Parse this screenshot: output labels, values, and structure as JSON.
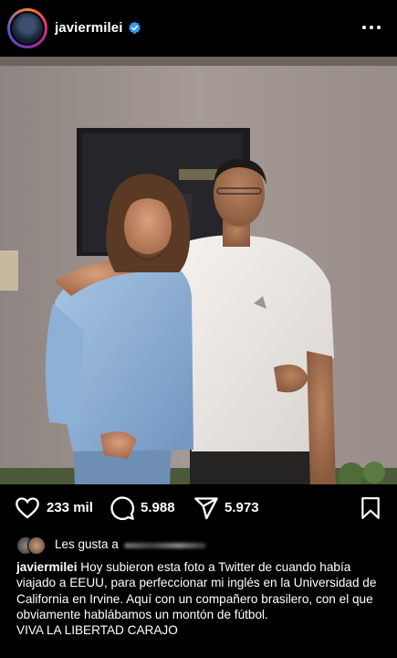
{
  "post": {
    "username": "javiermilei",
    "likes_count": "233 mil",
    "comments_count": "5.988",
    "shares_count": "5.973",
    "liked_by_prefix": "Les gusta a",
    "caption_user": "javiermilei",
    "caption_text": "Hoy subieron esta foto a Twitter de cuando había viajado a EEUU, para perfeccionar mi inglés en la Universidad de California en Irvine. Aquí con un compañero brasilero, con el que obviamente hablábamos un montón de fútbol.",
    "caption_line2": "VIVA LA LIBERTAD CARAJO"
  },
  "icons": [
    "heart-icon",
    "comment-icon",
    "share-icon",
    "bookmark-icon",
    "more-icon",
    "verified-icon"
  ],
  "colors": {
    "background": "#000000",
    "verified": "#3897f0",
    "text": "#ffffff"
  }
}
